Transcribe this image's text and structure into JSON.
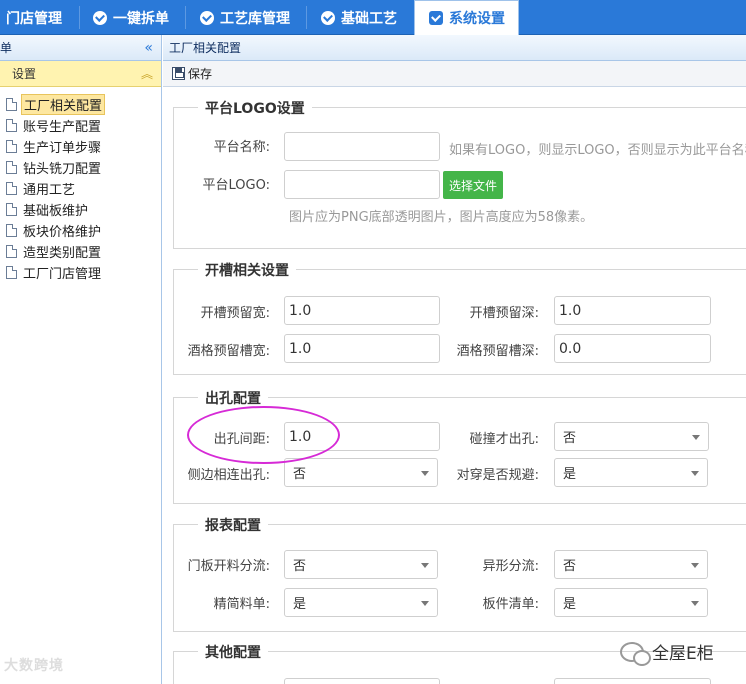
{
  "nav": {
    "tabs": [
      {
        "label": "门店管理",
        "icon": ""
      },
      {
        "label": "一键拆单",
        "icon": "check-circle-icon"
      },
      {
        "label": "工艺库管理",
        "icon": "check-circle-icon"
      },
      {
        "label": "基础工艺",
        "icon": "tag-icon"
      },
      {
        "label": "系统设置",
        "icon": "monitor-icon",
        "active": true
      }
    ]
  },
  "sidebar": {
    "title": "单",
    "collapse_icon": "«",
    "group": "设置",
    "group_icon": "︽",
    "items": [
      {
        "label": "工厂相关配置",
        "selected": true
      },
      {
        "label": "账号生产配置"
      },
      {
        "label": "生产订单步骤"
      },
      {
        "label": "钻头铣刀配置"
      },
      {
        "label": "通用工艺"
      },
      {
        "label": "基础板维护"
      },
      {
        "label": "板块价格维护"
      },
      {
        "label": "造型类别配置"
      },
      {
        "label": "工厂门店管理"
      }
    ]
  },
  "main": {
    "breadcrumb": "工厂相关配置",
    "save_label": "保存",
    "logo_section": {
      "legend": "平台LOGO设置",
      "name_label": "平台名称:",
      "name_value": "",
      "name_hint": "如果有LOGO，则显示LOGO，否则显示为此平台名称",
      "logo_label": "平台LOGO:",
      "logo_value": "",
      "file_button": "选择文件",
      "logo_hint": "图片应为PNG底部透明图片，图片高度应为58像素。"
    },
    "groove_section": {
      "legend": "开槽相关设置",
      "fields": [
        {
          "label": "开槽预留宽:",
          "value": "1.0"
        },
        {
          "label": "开槽预留深:",
          "value": "1.0"
        },
        {
          "label": "酒格预留槽宽:",
          "value": "1.0"
        },
        {
          "label": "酒格预留槽深:",
          "value": "0.0"
        }
      ]
    },
    "hole_section": {
      "legend": "出孔配置",
      "fields": [
        {
          "label": "出孔间距:",
          "value": "1.0"
        },
        {
          "label": "碰撞才出孔:",
          "value": "否"
        },
        {
          "label": "侧边相连出孔:",
          "value": "否"
        },
        {
          "label": "对穿是否规避:",
          "value": "是"
        }
      ]
    },
    "report_section": {
      "legend": "报表配置",
      "fields": [
        {
          "label": "门板开料分流:",
          "value": "否"
        },
        {
          "label": "异形分流:",
          "value": "否"
        },
        {
          "label": "精简料单:",
          "value": "是"
        },
        {
          "label": "板件清单:",
          "value": "是"
        }
      ]
    },
    "other_section": {
      "legend": "其他配置"
    }
  },
  "watermark": {
    "left": "大数跨境",
    "right": "全屋E柜"
  },
  "colors": {
    "nav_bg": "#2a79d8",
    "highlight": "#d62ad6",
    "file_button": "#44b549"
  }
}
